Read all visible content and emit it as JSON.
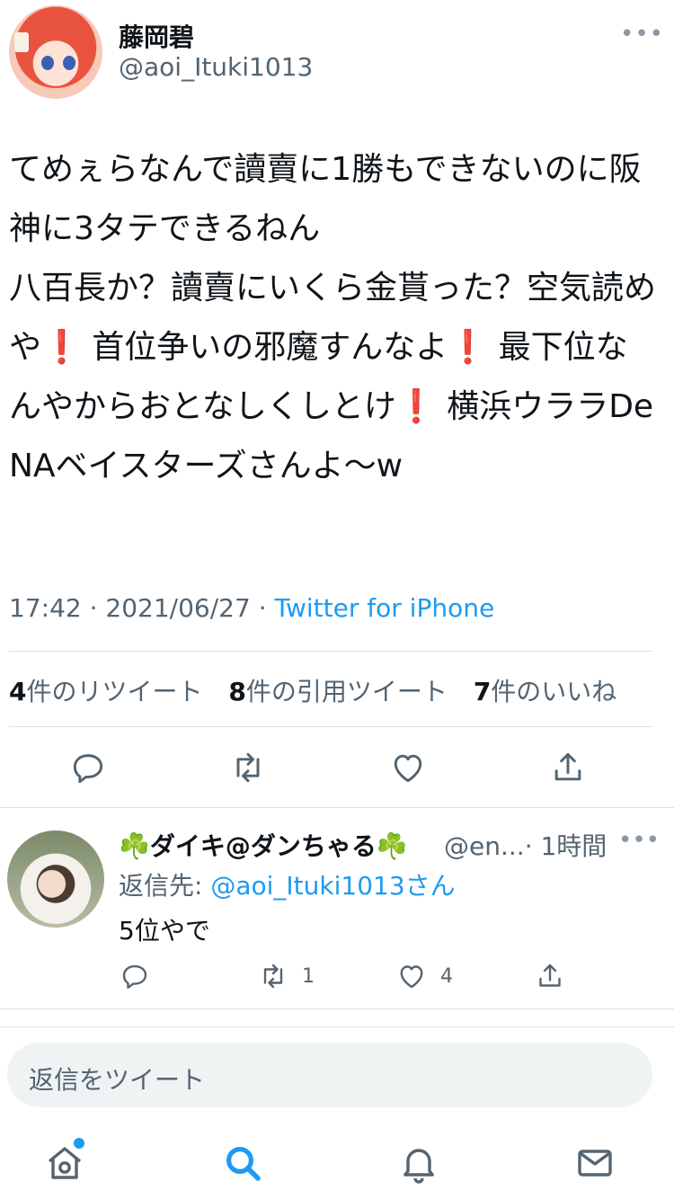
{
  "tweet": {
    "display_name": "藤岡碧",
    "handle": "@aoi_Ituki1013",
    "more_icon": "more-horizontal-icon",
    "text_parts": [
      {
        "t": "てめぇらなんで讀賣に1勝もできないのに阪神に3タテできるねん\n八百長か？讀賣にいくら金貰った？空気読めや"
      },
      {
        "t": "❗",
        "emoji": true
      },
      {
        "t": " 首位争いの邪魔すんなよ"
      },
      {
        "t": "❗",
        "emoji": true
      },
      {
        "t": " 最下位なんやからおとなしくしとけ"
      },
      {
        "t": "❗",
        "emoji": true
      },
      {
        "t": " 横浜ウララDeNAベイスターズさんよ〜w"
      }
    ],
    "time": "17:42",
    "date": "2021/06/27",
    "separator": "·",
    "source": "Twitter for iPhone",
    "stats": {
      "retweets_count": "4",
      "retweets_label": "件のリツイート",
      "quotes_count": "8",
      "quotes_label": "件の引用ツイート",
      "likes_count": "7",
      "likes_label": "件のいいね"
    }
  },
  "reply": {
    "display_name": "☘️ダイキ@ダンちゃる☘️",
    "handle": "@en...",
    "time": "· 1時間",
    "reply_to_prefix": "返信先: ",
    "reply_to_mention": "@aoi_Ituki1013",
    "reply_to_suffix": "さん",
    "text": "5位やで",
    "retweet_count": "1",
    "like_count": "4"
  },
  "compose": {
    "placeholder": "返信をツイート"
  },
  "tabbar": {
    "home": "home-icon",
    "search": "search-icon",
    "notifications": "bell-icon",
    "messages": "mail-icon"
  },
  "colors": {
    "accent": "#1d9bf0",
    "text": "#0f1419",
    "secondary": "#536471",
    "emoji_red": "#e0243b"
  }
}
